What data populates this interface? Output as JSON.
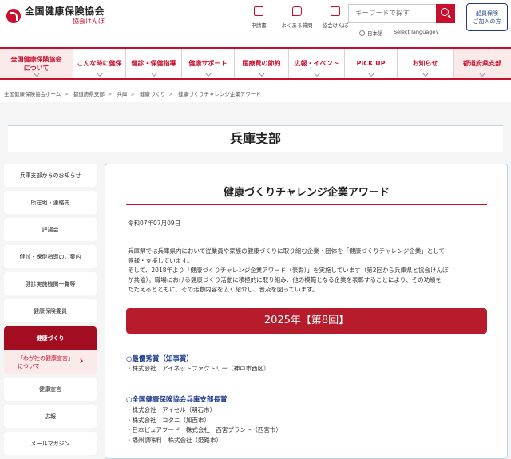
{
  "header": {
    "logo_title": "全国健康保険協会",
    "logo_sub": "協会けんぽ",
    "util_links": [
      {
        "label": "申請書",
        "icon": "document-icon"
      },
      {
        "label": "よくある質問",
        "icon": "question-bubble-icon"
      },
      {
        "label": "協会けんぽ",
        "icon": "building-icon"
      }
    ],
    "search_placeholder": "キーワードで探す",
    "lang_label": "日本語",
    "select_language": "Select language∨",
    "ship_button_line1": "船員保険",
    "ship_button_line2": "ご加入の方"
  },
  "nav": {
    "items": [
      {
        "line1": "全国健康保険協会",
        "line2": "について"
      },
      {
        "line1": "こんな時に健保",
        "line2": ""
      },
      {
        "line1": "健診・保健指導",
        "line2": ""
      },
      {
        "line1": "健康サポート",
        "line2": ""
      },
      {
        "line1": "医療費の節約",
        "line2": ""
      },
      {
        "line1": "広報・イベント",
        "line2": ""
      },
      {
        "line1": "PICK UP",
        "line2": ""
      },
      {
        "line1": "お知らせ",
        "line2": ""
      },
      {
        "line1": "都道府県支部",
        "line2": ""
      }
    ]
  },
  "breadcrumb": [
    "全国健康保険協会ホーム",
    "都道府県支部",
    "兵庫",
    "健康づくり",
    "健康づくりチャレンジ企業アワード"
  ],
  "page_title": "兵庫支部",
  "sidebar": {
    "items": [
      "兵庫支部からのお知らせ",
      "所在地・連絡先",
      "評議会",
      "健診・保健指導のご案内",
      "健診実施機関一覧等",
      "健康保険委員",
      "健康づくり"
    ],
    "sub_item_line1": "「わが社の健康宣言」",
    "sub_item_line2": "について",
    "items_after": [
      "健康宣言",
      "広報",
      "メールマガジン"
    ]
  },
  "article": {
    "title": "健康づくりチャレンジ企業アワード",
    "date": "令和07年07月09日",
    "para1_line1": "兵庫県では兵庫県内において従業員や家族の健康づくりに取り組む企業・団体を「健康づくりチャレンジ企業」として",
    "para1_line2": "登録・支援しています。",
    "para2_line1": "そして、2018年より「健康づくりチャレンジ企業アワード（表彰）」を実施しています（第2回から兵庫県と協会けんぽ",
    "para2_line2": "が共催）。職場における健康づくり活動に積極的に取り組み、他の模範となる企業を表彰することにより、その功績を",
    "para2_line3": "たたえるとともに、その活動内容を広く紹介し、普及を図っています。",
    "year_banner": "2025年【第8回】",
    "award1_head": "○最優秀賞（知事賞）",
    "award1_items": [
      "・株式会社　アイネットファクトリー（神戸市西区）"
    ],
    "award2_head": "○全国健康保険協会兵庫支部長賞",
    "award2_items": [
      "・株式会社　アイセル（明石市）",
      "・株式会社　コタニ（加西市）",
      "・日本ピュアフード　株式会社　西宮プラント（西宮市）",
      "・播州調味料　株式会社（姫路市）"
    ]
  },
  "colors": {
    "brand_red": "#c8102e",
    "banner_red": "#b71c2c",
    "link_blue": "#1f3b8c"
  }
}
